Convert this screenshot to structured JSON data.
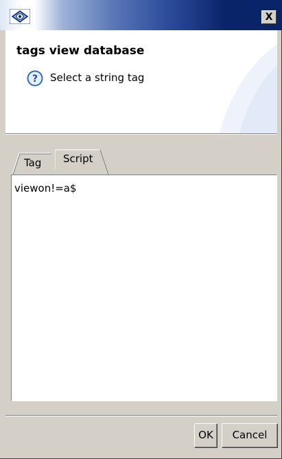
{
  "window": {
    "icon": "dialog-icon",
    "close_label": "X"
  },
  "header": {
    "title": "tags view database",
    "message_icon": "help-icon",
    "message": "Select a string tag"
  },
  "tabs": [
    {
      "label": "Tag",
      "selected": false
    },
    {
      "label": "Script",
      "selected": true
    }
  ],
  "editor": {
    "content": "viewon!=a$"
  },
  "buttons": {
    "ok_label": "OK",
    "cancel_label": "Cancel"
  }
}
